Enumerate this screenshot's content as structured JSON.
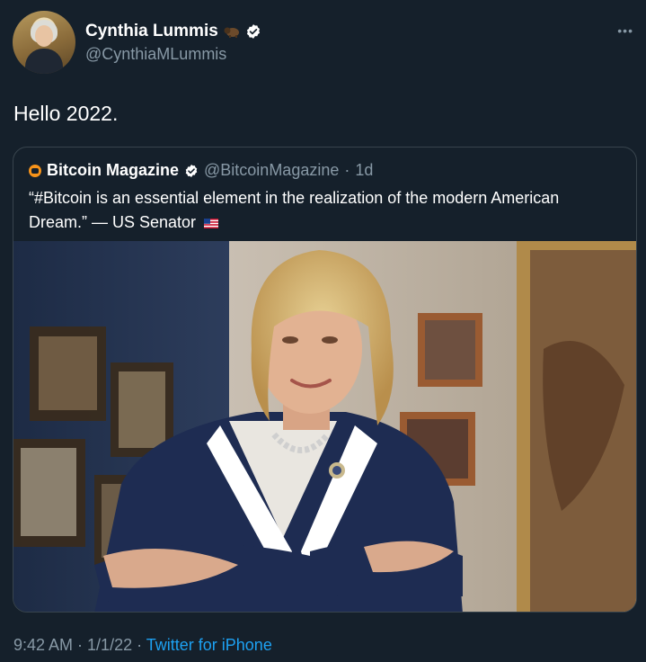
{
  "author": {
    "name": "Cynthia Lummis",
    "handle": "@CynthiaMLummis"
  },
  "tweet": {
    "text": "Hello 2022."
  },
  "quoted": {
    "name": "Bitcoin Magazine",
    "handle": "@BitcoinMagazine",
    "separator": "·",
    "time": "1d",
    "text": "“#Bitcoin is an essential element in the realization of the modern American Dream.” — US Senator"
  },
  "meta": {
    "time": "9:42 AM",
    "sep1": " · ",
    "date": "1/1/22",
    "sep2": " · ",
    "source": "Twitter for iPhone"
  },
  "icons": {
    "verified": "verified-badge-icon",
    "bison": "bison-emoji",
    "flag": "us-flag-emoji",
    "more": "more-icon"
  },
  "colors": {
    "background": "#15202b",
    "accent": "#1da1f2",
    "secondary_text": "#8899a6",
    "border": "#38444d"
  }
}
